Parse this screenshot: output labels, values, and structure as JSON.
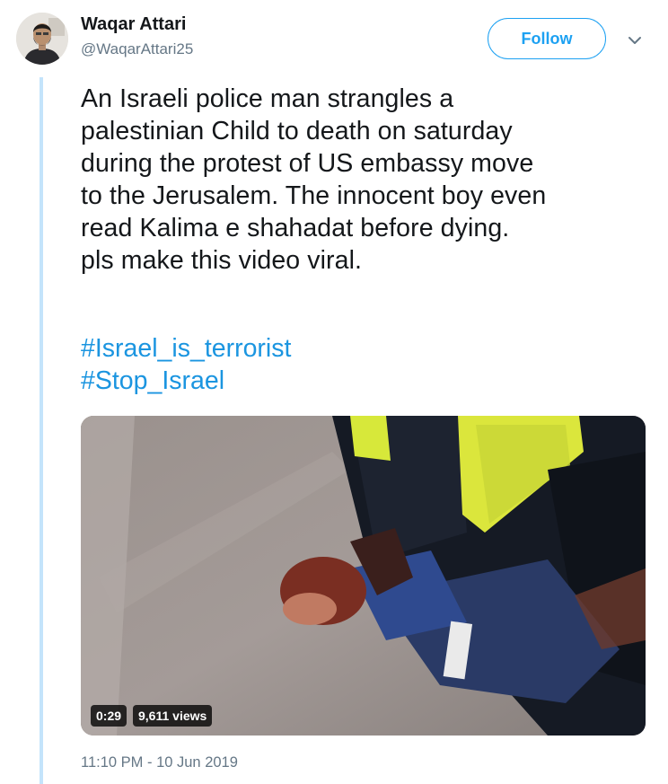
{
  "author": {
    "name": "Waqar Attari",
    "handle": "@WaqarAttari25"
  },
  "follow_label": "Follow",
  "tweet": {
    "text": "An Israeli police man strangles a\npalestinian Child to death on saturday\nduring the protest of US embassy move\nto the Jerusalem. The innocent boy even\nread Kalima e shahadat before dying.\npls make this video viral.",
    "hashtags": [
      "#Israel_is_terrorist",
      "#Stop_Israel"
    ]
  },
  "video": {
    "duration": "0:29",
    "views": "9,611 views"
  },
  "timestamp": "11:10 PM - 10 Jun 2019",
  "colors": {
    "accent": "#1da1f2",
    "link": "#1b95e0",
    "muted": "#657786",
    "thread_line": "#c4e4fb"
  },
  "icons": {
    "more": "chevron-down-icon"
  }
}
